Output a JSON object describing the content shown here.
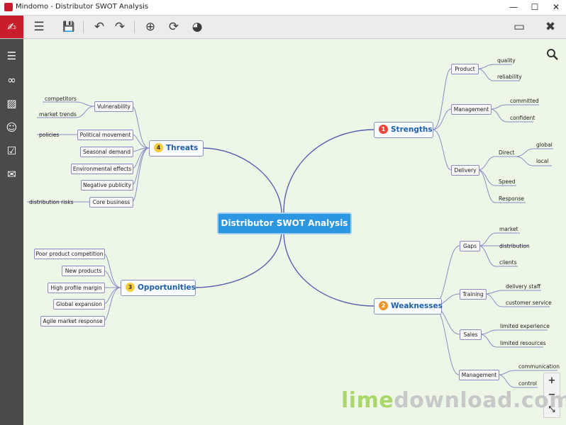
{
  "window": {
    "title": "Mindomo - Distributor SWOT Analysis",
    "controls": [
      "—",
      "☐",
      "✕"
    ]
  },
  "toolbar": {
    "menu_icon": "☰",
    "save_icon": "💾",
    "undo_icon": "↶",
    "redo_icon": "↷",
    "add_icon": "⊕",
    "connect_icon": "⟳",
    "palette_icon": "◕",
    "present_icon": "▭",
    "close_icon": "✖"
  },
  "sidebar": {
    "items": [
      {
        "name": "outline",
        "glyph": "☰"
      },
      {
        "name": "link",
        "glyph": "∞"
      },
      {
        "name": "image",
        "glyph": "▨"
      },
      {
        "name": "emoticon",
        "glyph": "☺"
      },
      {
        "name": "tasks",
        "glyph": "☑"
      },
      {
        "name": "comments",
        "glyph": "✉"
      }
    ]
  },
  "map": {
    "central": "Distributor SWOT Analysis",
    "strengths": {
      "label": "Strengths",
      "badge": "1",
      "product": {
        "label": "Product",
        "items": [
          "quality",
          "reliability"
        ]
      },
      "management": {
        "label": "Management",
        "items": [
          "committed",
          "confident"
        ]
      },
      "delivery": {
        "label": "Delivery",
        "direct": {
          "label": "Direct",
          "items": [
            "global",
            "local"
          ]
        },
        "items": [
          "Speed",
          "Response"
        ]
      }
    },
    "weaknesses": {
      "label": "Weaknesses",
      "badge": "2",
      "gaps": {
        "label": "Gaps",
        "items": [
          "market",
          "distribution",
          "clients"
        ]
      },
      "training": {
        "label": "Training",
        "items": [
          "delivery staff",
          "customer service"
        ]
      },
      "sales": {
        "label": "Sales",
        "items": [
          "limited experience",
          "limited resources"
        ]
      },
      "management": {
        "label": "Management",
        "items": [
          "communication",
          "control"
        ]
      }
    },
    "opportunities": {
      "label": "Opportunities",
      "badge": "3",
      "items": [
        "Poor product competition",
        "New products",
        "High profile margin",
        "Global expansion",
        "Agile market response"
      ]
    },
    "threats": {
      "label": "Threats",
      "badge": "4",
      "vulnerability": {
        "label": "Vulnerability",
        "items": [
          "competitors",
          "market trends"
        ]
      },
      "political": {
        "label": "Political movement",
        "items": [
          "policies"
        ]
      },
      "items": [
        "Seasonal demand",
        "Environmental effects",
        "Negative publicity"
      ],
      "core": {
        "label": "Core business",
        "items": [
          "distribution risks"
        ]
      }
    }
  },
  "zoom": {
    "in": "+",
    "out": "−",
    "fit": "⤡"
  },
  "watermark": {
    "part1": "lime",
    "part2": "download.com"
  }
}
